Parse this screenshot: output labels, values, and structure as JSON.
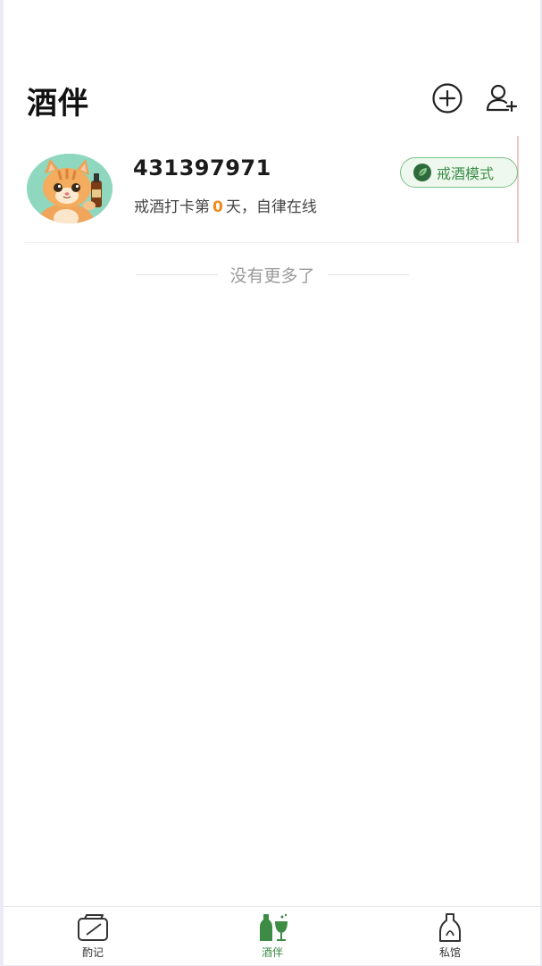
{
  "header": {
    "title": "酒伴"
  },
  "friend": {
    "username": "431397971",
    "status_prefix": "戒酒打卡第",
    "days": "0",
    "status_suffix": "天，自律在线",
    "mode_badge": "戒酒模式"
  },
  "list_end_text": "没有更多了",
  "tabbar": {
    "tabs": [
      {
        "label": "酌记",
        "icon": "journal-icon",
        "active": false
      },
      {
        "label": "酒伴",
        "icon": "drinks-icon",
        "active": true
      },
      {
        "label": "私馆",
        "icon": "bottle-icon",
        "active": false
      }
    ]
  },
  "colors": {
    "accent_green": "#3d8b45",
    "days_orange": "#f08a1c",
    "badge_border": "#7bbf84",
    "avatar_bg": "#8fd8bf"
  }
}
